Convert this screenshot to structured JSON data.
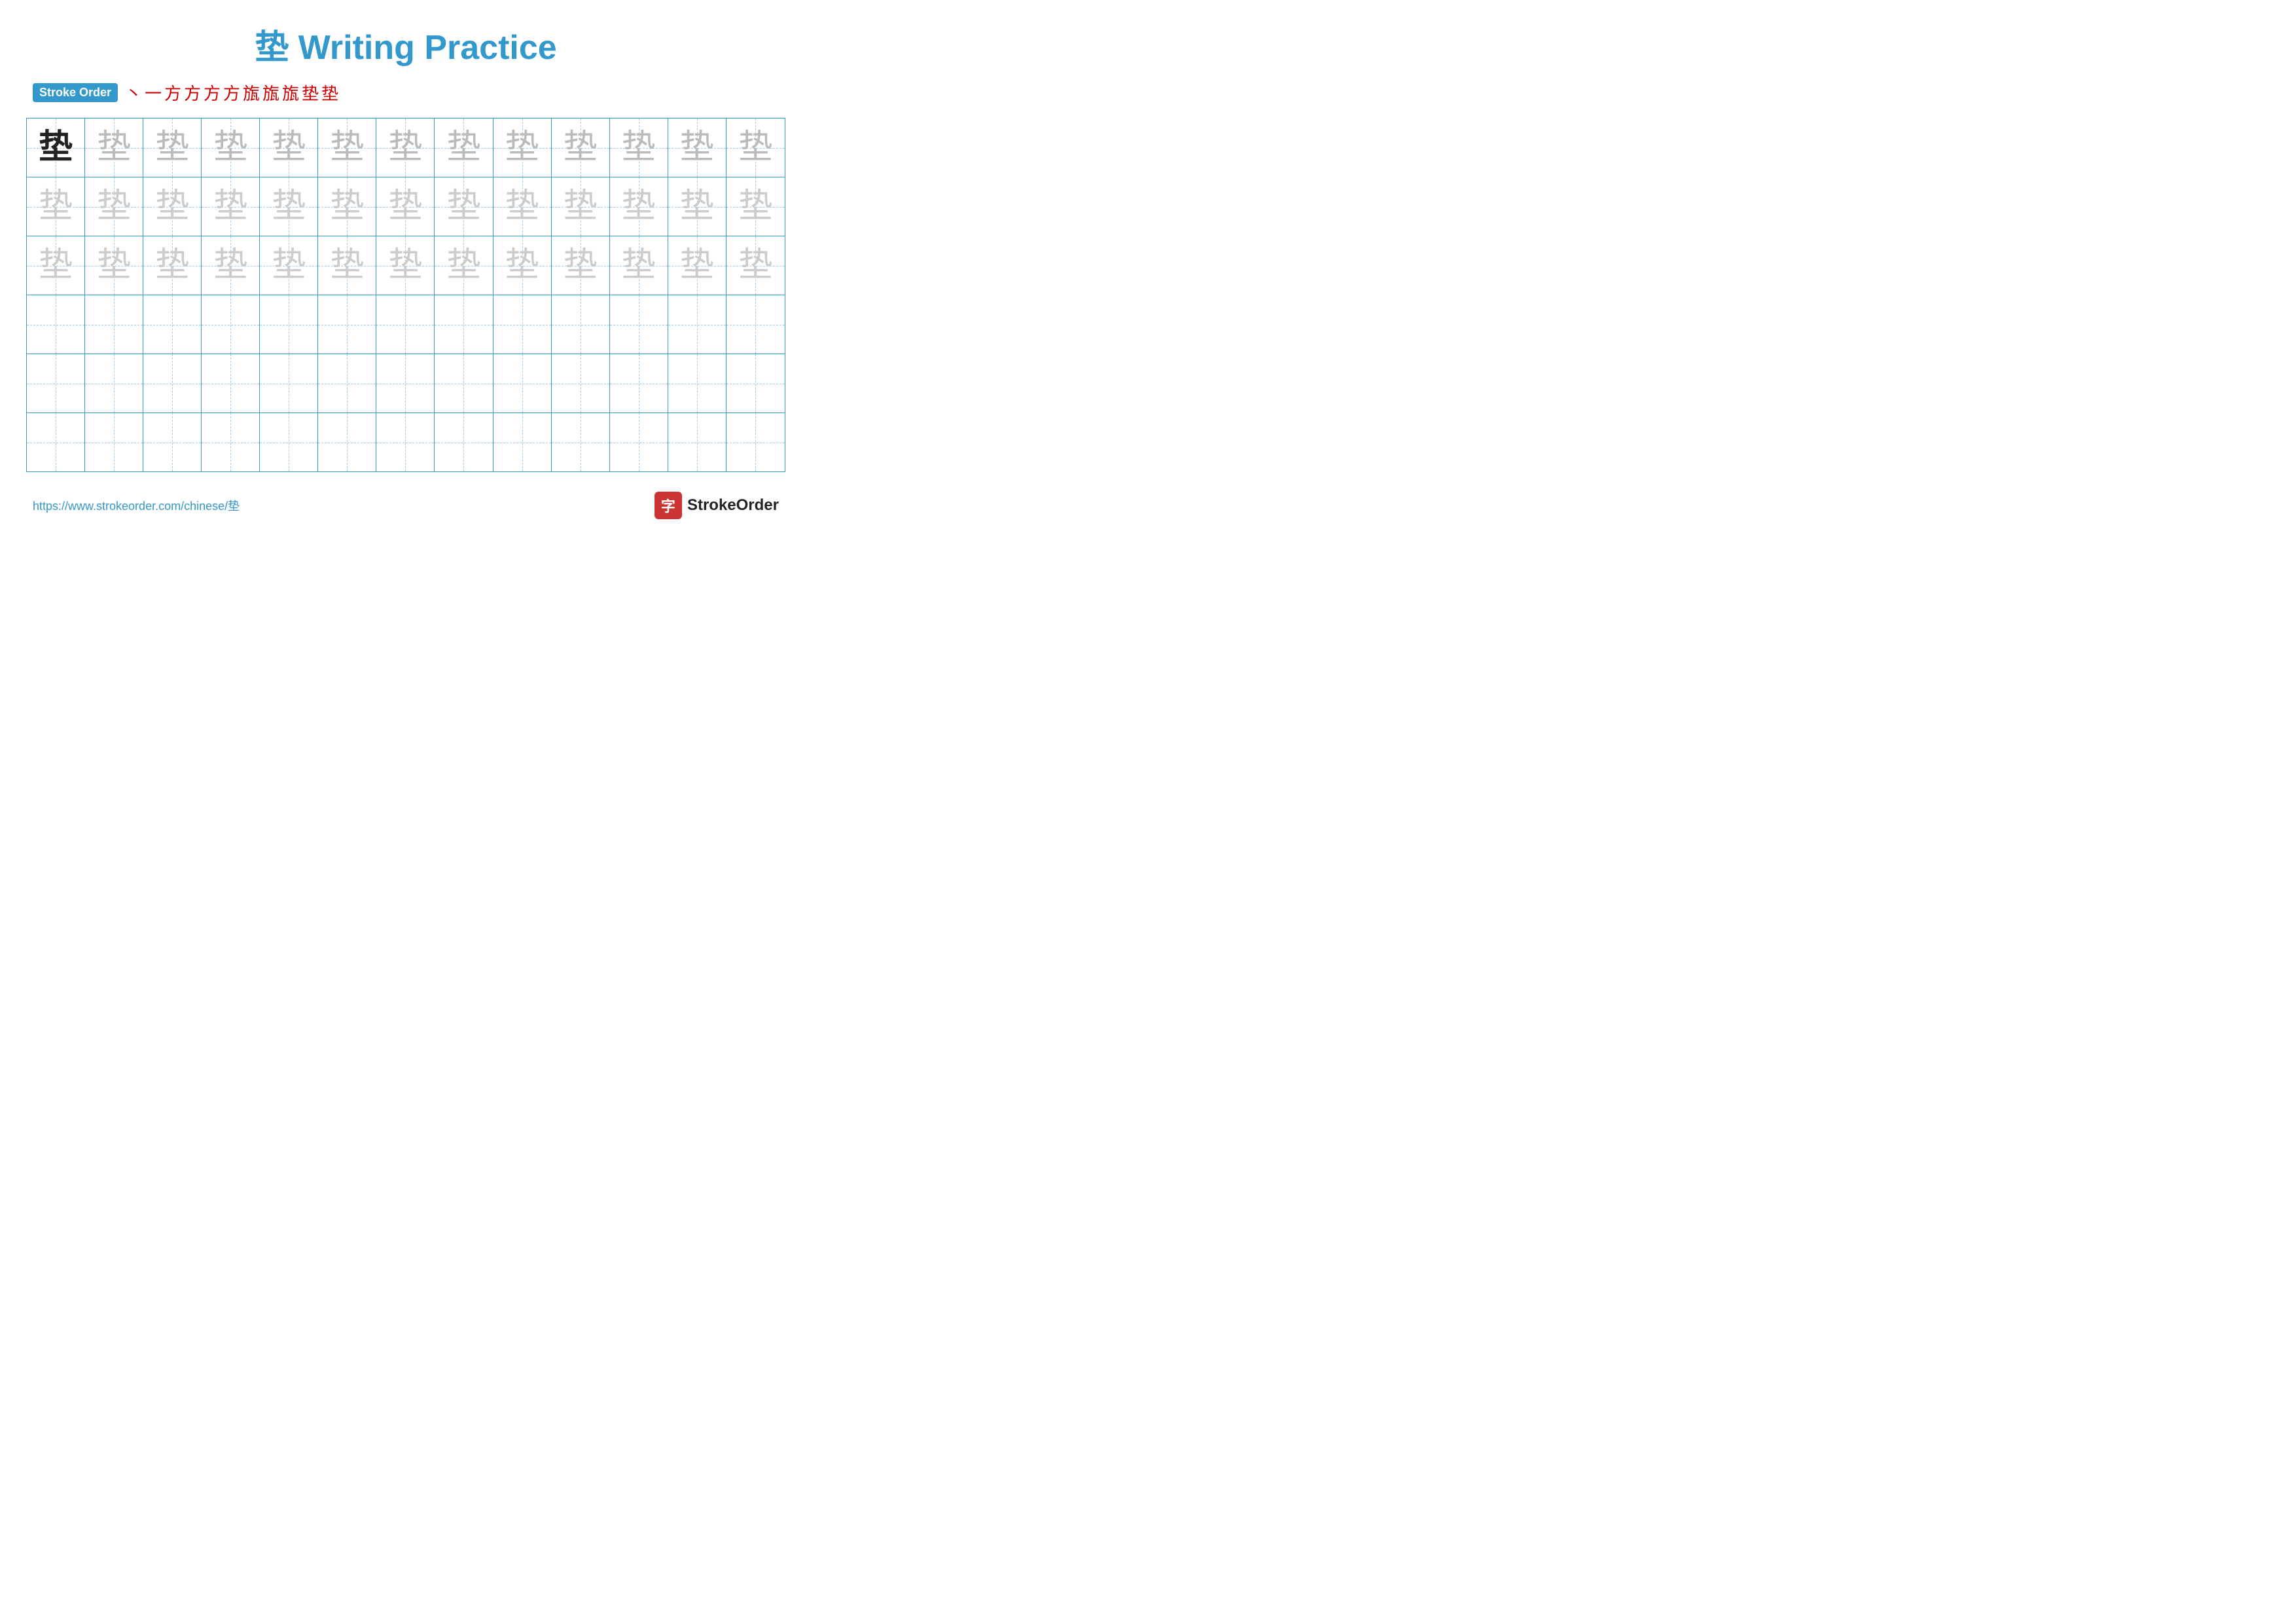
{
  "title": {
    "character": "垫",
    "label": "Writing Practice",
    "full": "垫 Writing Practice"
  },
  "stroke_order": {
    "badge": "Stroke Order",
    "strokes": [
      "丶",
      "一",
      "方",
      "方",
      "方",
      "方",
      "旊",
      "旊",
      "旊",
      "垫",
      "垫"
    ]
  },
  "grid": {
    "cols": 13,
    "rows": 6,
    "character": "垫",
    "guide_char": "垫"
  },
  "footer": {
    "url": "https://www.strokeorder.com/chinese/垫",
    "brand_char": "字",
    "brand_name": "StrokeOrder"
  }
}
